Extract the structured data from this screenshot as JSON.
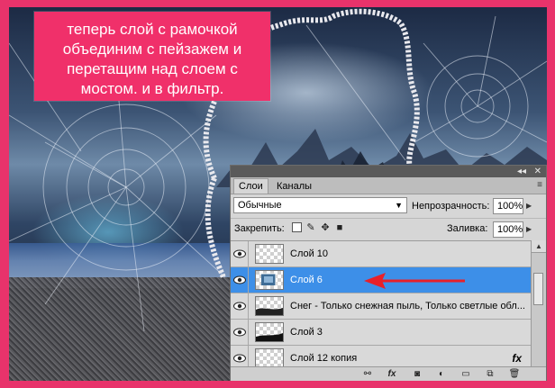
{
  "caption": {
    "lines": [
      "теперь слой с рамочкой",
      "объединим с пейзажем и",
      "перетащим над слоем с",
      "мостом. и в фильтр."
    ]
  },
  "layers_panel": {
    "header_icons": {
      "collapse": "◂◂",
      "close": "✕"
    },
    "tabs": [
      {
        "label": "Слои",
        "active": true
      },
      {
        "label": "Каналы",
        "active": false
      }
    ],
    "panel_menu_icon": "≡",
    "blend_mode": "Обычные",
    "opacity_label": "Непрозрачность:",
    "opacity_value": "100%",
    "lock_label": "Закрепить:",
    "fill_label": "Заливка:",
    "fill_value": "100%",
    "layers": [
      {
        "name": "Слой 10",
        "selected": false,
        "visible": true,
        "fx": ""
      },
      {
        "name": "Слой 6",
        "selected": true,
        "visible": true,
        "fx": ""
      },
      {
        "name": "Снег - Только снежная пыль, Только светлые обл...",
        "selected": false,
        "visible": true,
        "fx": ""
      },
      {
        "name": "Слой 3",
        "selected": false,
        "visible": true,
        "fx": ""
      },
      {
        "name": "Слой 12 копия",
        "selected": false,
        "visible": true,
        "fx": "fx"
      }
    ],
    "bottom_icons": [
      "link-icon",
      "fx-icon",
      "mask-icon",
      "adjustment-icon",
      "folder-icon",
      "new-layer-icon",
      "trash-icon"
    ],
    "fx_glyph": "fx"
  },
  "colors": {
    "frame_pink": "#e8336b",
    "caption_bg": "#f0306a",
    "selected_row": "#3d8fe8",
    "pointer_arrow": "#e8202a"
  }
}
